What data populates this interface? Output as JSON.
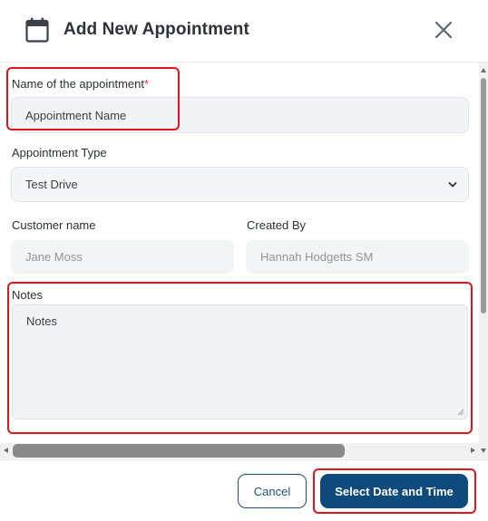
{
  "header": {
    "title": "Add New Appointment",
    "icon": "calendar-icon",
    "close_icon": "close-icon"
  },
  "form": {
    "appointment_name": {
      "label": "Name of the appointment",
      "required_mark": "*",
      "value": "Appointment Name"
    },
    "appointment_type": {
      "label": "Appointment Type",
      "selected": "Test Drive"
    },
    "customer_name": {
      "label": "Customer name",
      "value": "Jane Moss"
    },
    "created_by": {
      "label": "Created By",
      "value": "Hannah Hodgetts SM"
    },
    "notes": {
      "label": "Notes",
      "value": "Notes"
    }
  },
  "footer": {
    "cancel_label": "Cancel",
    "primary_label": "Select Date and Time"
  },
  "colors": {
    "primary": "#0f4a7c",
    "highlight": "#e0161d",
    "field_bg": "#f1f3f6",
    "required": "#d93a3a"
  }
}
